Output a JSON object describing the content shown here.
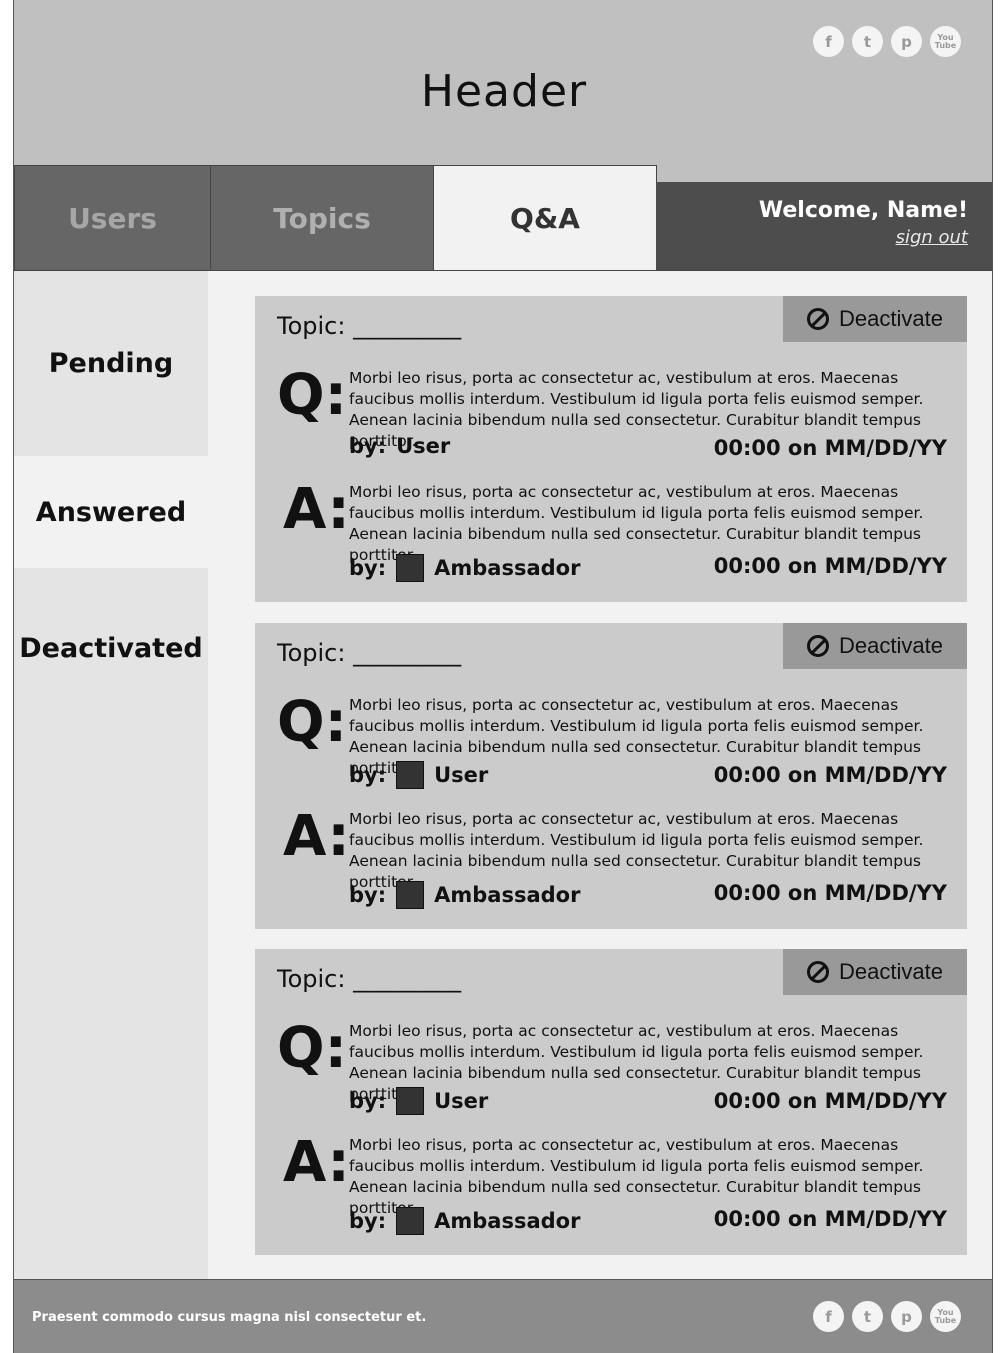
{
  "header": {
    "title": "Header"
  },
  "social": [
    "f",
    "t",
    "p",
    "You Tube"
  ],
  "nav": {
    "users": "Users",
    "topics": "Topics",
    "qa": "Q&A"
  },
  "welcome": {
    "text": "Welcome, Name!",
    "signout": "sign out"
  },
  "sidebar": {
    "pending": "Pending",
    "answered": "Answered",
    "deactivated": "Deactivated"
  },
  "cards": [
    {
      "deactivate": "Deactivate",
      "topic": "Topic: _________",
      "q_letter": "Q:",
      "question": "Morbi leo risus, porta ac consectetur ac, vestibulum at eros. Maecenas faucibus mollis interdum. Vestibulum id ligula porta felis euismod semper. Aenean lacinia bibendum nulla sed consectetur. Curabitur blandit tempus porttitor.",
      "q_by": "by:",
      "q_user": "User",
      "q_time": "00:00 on MM/DD/YY",
      "a_letter": "A:",
      "answer": "Morbi leo risus, porta ac consectetur ac, vestibulum at eros. Maecenas faucibus mollis interdum. Vestibulum id ligula porta felis euismod semper. Aenean lacinia bibendum nulla sed consectetur. Curabitur blandit tempus porttitor.",
      "a_by": "by:",
      "a_user": "Ambassador",
      "a_time": "00:00 on MM/DD/YY"
    },
    {
      "deactivate": "Deactivate",
      "topic": "Topic: _________",
      "q_letter": "Q:",
      "question": "Morbi leo risus, porta ac consectetur ac, vestibulum at eros. Maecenas faucibus mollis interdum. Vestibulum id ligula porta felis euismod semper. Aenean lacinia bibendum nulla sed consectetur. Curabitur blandit tempus porttitor.",
      "q_by": "by:",
      "q_user": "User",
      "q_time": "00:00 on MM/DD/YY",
      "a_letter": "A:",
      "answer": "Morbi leo risus, porta ac consectetur ac, vestibulum at eros. Maecenas faucibus mollis interdum. Vestibulum id ligula porta felis euismod semper. Aenean lacinia bibendum nulla sed consectetur. Curabitur blandit tempus porttitor.",
      "a_by": "by:",
      "a_user": "Ambassador",
      "a_time": "00:00 on MM/DD/YY"
    },
    {
      "deactivate": "Deactivate",
      "topic": "Topic: _________",
      "q_letter": "Q:",
      "question": "Morbi leo risus, porta ac consectetur ac, vestibulum at eros. Maecenas faucibus mollis interdum. Vestibulum id ligula porta felis euismod semper. Aenean lacinia bibendum nulla sed consectetur. Curabitur blandit tempus porttitor.",
      "q_by": "by:",
      "q_user": "User",
      "q_time": "00:00 on MM/DD/YY",
      "a_letter": "A:",
      "answer": "Morbi leo risus, porta ac consectetur ac, vestibulum at eros. Maecenas faucibus mollis interdum. Vestibulum id ligula porta felis euismod semper. Aenean lacinia bibendum nulla sed consectetur. Curabitur blandit tempus porttitor.",
      "a_by": "by:",
      "a_user": "Ambassador",
      "a_time": "00:00 on MM/DD/YY"
    }
  ],
  "footer": {
    "text": "Praesent commodo cursus magna nisl consectetur et."
  }
}
